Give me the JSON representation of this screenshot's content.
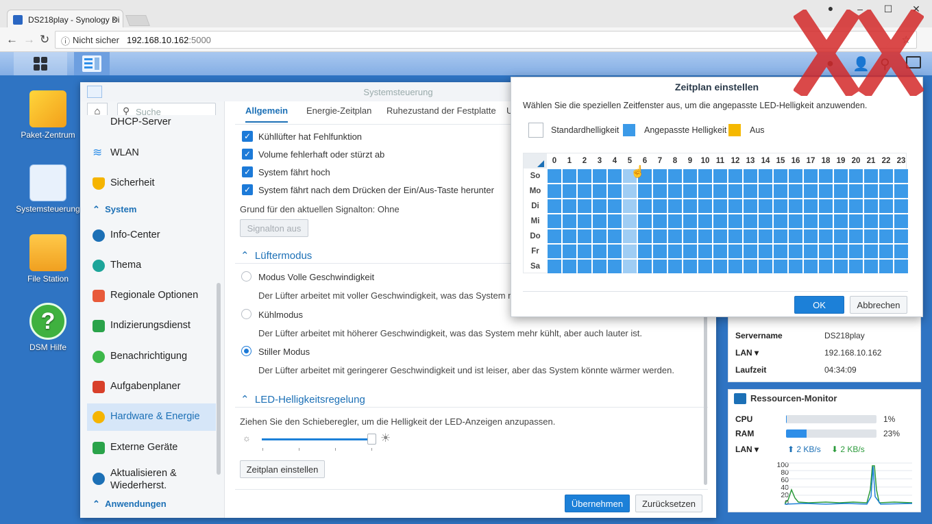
{
  "browser": {
    "tab_title": "DS218play - Synology Di",
    "tab_close": "×",
    "not_secure": "Nicht sicher",
    "url_host": "192.168.10.162",
    "url_port": ":5000",
    "window_buttons": [
      "–",
      "☐",
      "✕"
    ]
  },
  "desktop": {
    "icons": [
      {
        "label": "Paket-Zentrum",
        "icon": "package-center-icon"
      },
      {
        "label": "Systemsteuerung",
        "icon": "control-panel-icon"
      },
      {
        "label": "File Station",
        "icon": "file-station-icon"
      },
      {
        "label": "DSM Hilfe",
        "icon": "help-icon"
      }
    ]
  },
  "window": {
    "title": "Systemsteuerung",
    "search_placeholder": "Suche",
    "sidebar": {
      "partial_item": "DHCP-Server",
      "items": [
        {
          "label": "WLAN",
          "color": "#2e8ee8"
        },
        {
          "label": "Sicherheit",
          "color": "#f5b400"
        },
        {
          "label": "Info-Center",
          "color": "#1c70b6"
        },
        {
          "label": "Thema",
          "color": "#1da59a"
        },
        {
          "label": "Regionale Optionen",
          "color": "#e85a3a"
        },
        {
          "label": "Indizierungsdienst",
          "color": "#2aa34a"
        },
        {
          "label": "Benachrichtigung",
          "color": "#3db84a"
        },
        {
          "label": "Aufgabenplaner",
          "color": "#d8402a"
        },
        {
          "label": "Hardware & Energie",
          "color": "#f5b400"
        },
        {
          "label": "Externe Geräte",
          "color": "#2aa34a"
        },
        {
          "label": "Aktualisieren &",
          "label2": "Wiederherst.",
          "color": "#1c70b6"
        }
      ],
      "section_system": "System",
      "section_apps": "Anwendungen"
    },
    "tabs": [
      "Allgemein",
      "Energie-Zeitplan",
      "Ruhezustand der Festplatte",
      "U"
    ],
    "beep_checks": [
      "Kühllüfter hat Fehlfunktion",
      "Volume fehlerhaft oder stürzt ab",
      "System fährt hoch",
      "System fährt nach dem Drücken der Ein/Aus-Taste herunter"
    ],
    "beep_reason": "Grund für den aktuellen Signalton: Ohne",
    "beep_off_button": "Signalton aus",
    "fan_section": "Lüftermodus",
    "fan_modes": [
      {
        "label": "Modus Volle Geschwindigkeit",
        "desc": "Der Lüfter arbeitet mit voller Geschwindigkeit, was das System mehr",
        "selected": false
      },
      {
        "label": "Kühlmodus",
        "desc": "Der Lüfter arbeitet mit höherer Geschwindigkeit, was das System mehr kühlt, aber auch lauter ist.",
        "selected": false
      },
      {
        "label": "Stiller Modus",
        "desc": "Der Lüfter arbeitet mit geringerer Geschwindigkeit und ist leiser, aber das System könnte wärmer werden.",
        "selected": true
      }
    ],
    "led_section": "LED-Helligkeitsregelung",
    "led_desc": "Ziehen Sie den Schieberegler, um die Helligkeit der LED-Anzeigen anzupassen.",
    "led_level": 1.0,
    "schedule_button": "Zeitplan einstellen",
    "apply_button": "Übernehmen",
    "reset_button": "Zurücksetzen"
  },
  "widgets": {
    "system": [
      {
        "key": "Servername",
        "value": "DS218play"
      },
      {
        "key": "LAN ▾",
        "value": "192.168.10.162"
      },
      {
        "key": "Laufzeit",
        "value": "04:34:09"
      }
    ],
    "resource": {
      "title": "Ressourcen-Monitor",
      "cpu_label": "CPU",
      "cpu_value": "1%",
      "cpu": 0.01,
      "ram_label": "RAM",
      "ram_value": "23%",
      "ram": 0.23,
      "lan_label": "LAN ▾",
      "lan_up": "2 KB/s",
      "lan_down": "2 KB/s",
      "y_ticks": [
        "100",
        "80",
        "60",
        "40",
        "20",
        "0"
      ]
    }
  },
  "dialog": {
    "title": "Zeitplan einstellen",
    "desc": "Wählen Sie die speziellen Zeitfenster aus, um die angepasste LED-Helligkeit anzuwenden.",
    "legend": [
      {
        "label": "Standardhelligkeit",
        "color": "#ffffff"
      },
      {
        "label": "Angepasste Helligkeit",
        "color": "#3b9ae8"
      },
      {
        "label": "Aus",
        "color": "#f5b800"
      }
    ],
    "hours": [
      "0",
      "1",
      "2",
      "3",
      "4",
      "5",
      "6",
      "7",
      "8",
      "9",
      "10",
      "11",
      "12",
      "13",
      "14",
      "15",
      "16",
      "17",
      "18",
      "19",
      "20",
      "21",
      "22",
      "23"
    ],
    "days": [
      "So",
      "Mo",
      "Di",
      "Mi",
      "Do",
      "Fr",
      "Sa"
    ],
    "highlight_hour": 5,
    "ok_button": "OK",
    "cancel_button": "Abbrechen"
  }
}
